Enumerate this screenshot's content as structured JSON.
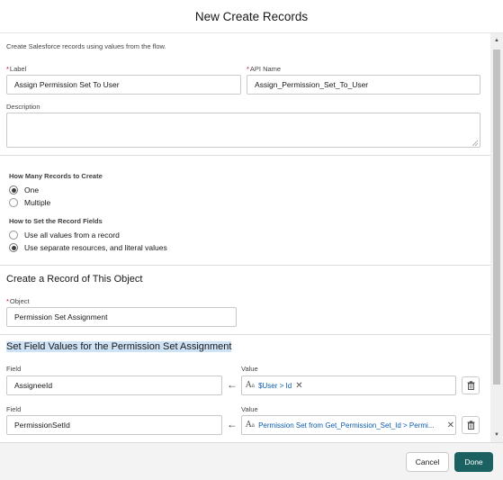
{
  "dialog": {
    "title": "New Create Records"
  },
  "intro": "Create Salesforce records using values from the flow.",
  "label_field": {
    "label": "Label",
    "required_mark": "*",
    "value": "Assign Permission Set To User"
  },
  "api_name_field": {
    "label": "API Name",
    "required_mark": "*",
    "value": "Assign_Permission_Set_To_User"
  },
  "description_field": {
    "label": "Description",
    "value": ""
  },
  "how_many": {
    "label": "How Many Records to Create",
    "options": [
      {
        "label": "One",
        "selected": true
      },
      {
        "label": "Multiple",
        "selected": false
      }
    ]
  },
  "how_to_set": {
    "label": "How to Set the Record Fields",
    "options": [
      {
        "label": "Use all values from a record",
        "selected": false
      },
      {
        "label": "Use separate resources, and literal values",
        "selected": true
      }
    ]
  },
  "object_section": {
    "title": "Create a Record of This Object",
    "object_label": "Object",
    "required_mark": "*",
    "object_value": "Permission Set Assignment"
  },
  "field_values_section": {
    "title": "Set Field Values for the Permission Set Assignment",
    "rows": [
      {
        "field_label": "Field",
        "field": "AssigneeId",
        "value_label": "Value",
        "value_icon": "text-type-icon",
        "value": "$User > Id"
      },
      {
        "field_label": "Field",
        "field": "PermissionSetId",
        "value_label": "Value",
        "value_icon": "text-type-icon",
        "value": "Permission Set from Get_Permission_Set_Id > Permi..."
      }
    ]
  },
  "footer": {
    "cancel_label": "Cancel",
    "done_label": "Done"
  },
  "colors": {
    "primary": "#1b6161",
    "link": "#0b5cab",
    "selection_highlight": "#cfe3f7",
    "required": "#ba0517"
  }
}
